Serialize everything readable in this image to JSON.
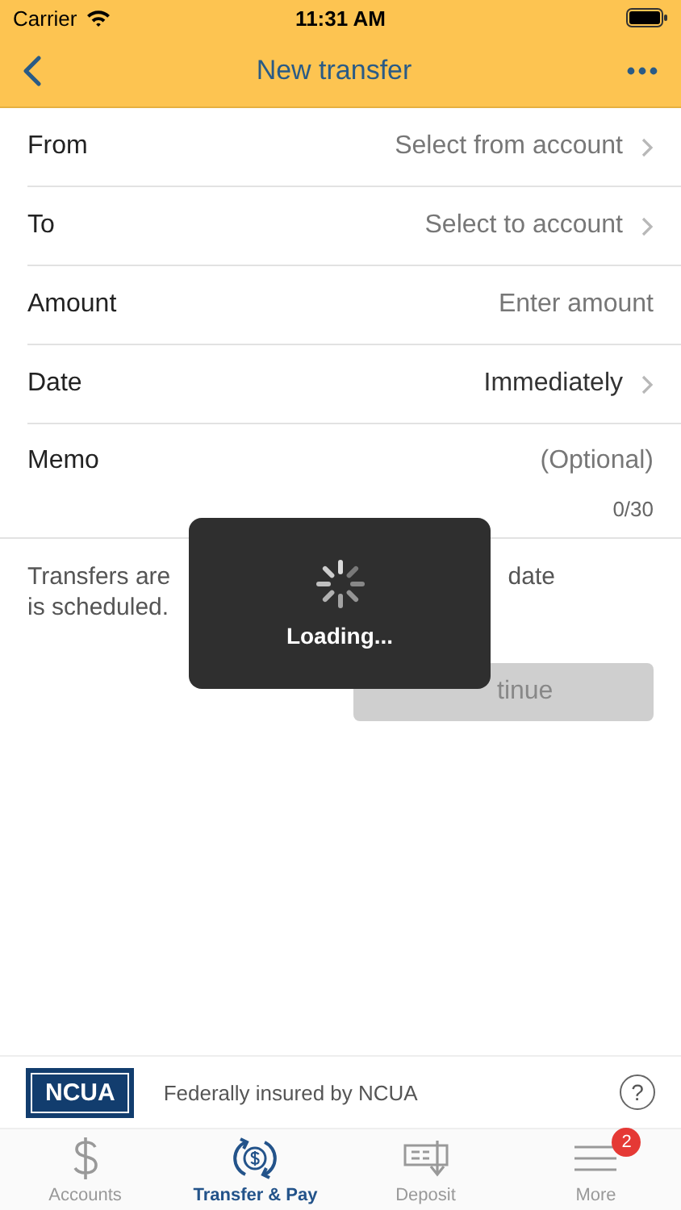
{
  "status_bar": {
    "carrier": "Carrier",
    "time": "11:31 AM"
  },
  "nav": {
    "title": "New transfer"
  },
  "fields": [
    {
      "label": "From",
      "placeholder": "Select from account",
      "kind": "select"
    },
    {
      "label": "To",
      "placeholder": "Select to account",
      "kind": "select"
    },
    {
      "label": "Amount",
      "placeholder": "Enter amount",
      "kind": "input"
    },
    {
      "label": "Date",
      "value": "Immediately",
      "kind": "select"
    },
    {
      "label": "Memo",
      "placeholder": "(Optional)",
      "kind": "input",
      "counter": "0/30"
    }
  ],
  "note": [
    {
      "text": "Transfers are"
    },
    {
      "text": "date"
    },
    {
      "text": "is scheduled."
    }
  ],
  "continue_button": {
    "label": "tinue",
    "disabled": true
  },
  "loading": {
    "text": "Loading..."
  },
  "footer": {
    "logo": "NCUA",
    "text": "Federally insured by NCUA",
    "help": "?"
  },
  "tabs": [
    {
      "label": "Accounts",
      "kind": "dollar",
      "selected": false
    },
    {
      "label": "Transfer & Pay",
      "kind": "transfer",
      "selected": true
    },
    {
      "label": "Deposit",
      "kind": "deposit",
      "selected": false
    },
    {
      "label": "More",
      "kind": "menu",
      "selected": false,
      "badge": "2"
    }
  ]
}
